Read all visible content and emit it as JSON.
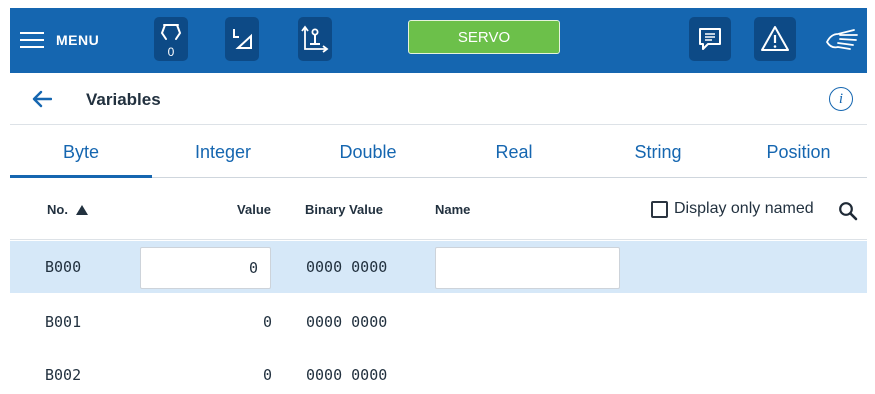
{
  "header": {
    "menu_label": "MENU",
    "tool_badge": "0",
    "servo_label": "SERVO",
    "icons": [
      "hamburger-icon",
      "gripper-icon",
      "coordinate-frame-icon",
      "robot-axes-icon",
      "message-icon",
      "warning-icon",
      "hand-icon"
    ],
    "colors": {
      "bar": "#1566b0",
      "button": "#0d4a86",
      "servo": "#6cc04a"
    }
  },
  "titlebar": {
    "title": "Variables",
    "info_label": "i"
  },
  "tabs": [
    "Byte",
    "Integer",
    "Double",
    "Real",
    "String",
    "Position"
  ],
  "active_tab": "Byte",
  "table": {
    "columns": {
      "no": "No.",
      "value": "Value",
      "binary": "Binary Value",
      "name": "Name"
    },
    "sort": "ascending",
    "filter_label": "Display only named",
    "filter_checked": false,
    "rows": [
      {
        "no": "B000",
        "value": "0",
        "binary": "0000 0000",
        "name": "",
        "selected": true
      },
      {
        "no": "B001",
        "value": "0",
        "binary": "0000 0000",
        "name": ""
      },
      {
        "no": "B002",
        "value": "0",
        "binary": "0000 0000",
        "name": ""
      }
    ]
  }
}
